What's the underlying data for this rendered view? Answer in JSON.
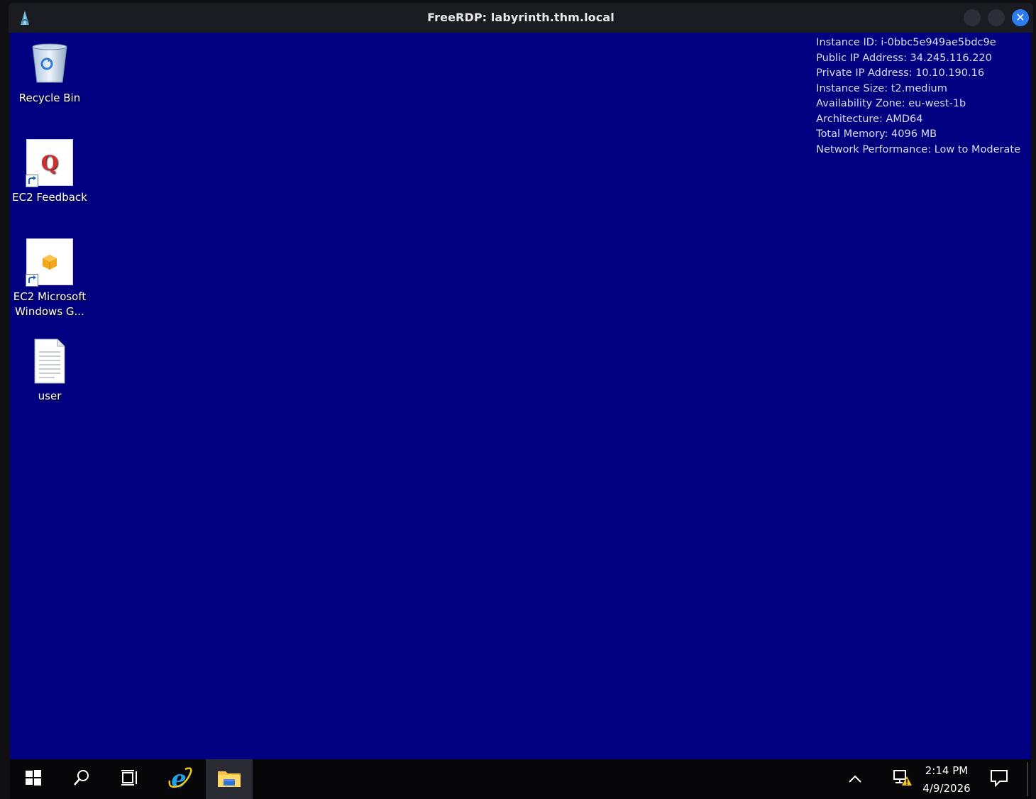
{
  "window": {
    "title": "FreeRDP: labyrinth.thm.local"
  },
  "desktop": {
    "background_color": "#000080",
    "icons": [
      {
        "label": "Recycle Bin",
        "icon": "recycle-bin-icon"
      },
      {
        "label": "EC2 Feedback",
        "icon": "ec2-feedback-icon"
      },
      {
        "label": "EC2 Microsoft Windows G...",
        "icon": "ec2-windows-guide-icon"
      },
      {
        "label": "user",
        "icon": "text-document-icon"
      }
    ],
    "instance_info": [
      "Instance ID: i-0bbc5e949ae5bdc9e",
      "Public IP Address: 34.245.116.220",
      "Private IP Address: 10.10.190.16",
      "Instance Size: t2.medium",
      "Availability Zone: eu-west-1b",
      "Architecture: AMD64",
      "Total Memory: 4096 MB",
      "Network Performance: Low to Moderate"
    ]
  },
  "taskbar": {
    "time": "2:14 PM",
    "date": "4/9/2026"
  }
}
